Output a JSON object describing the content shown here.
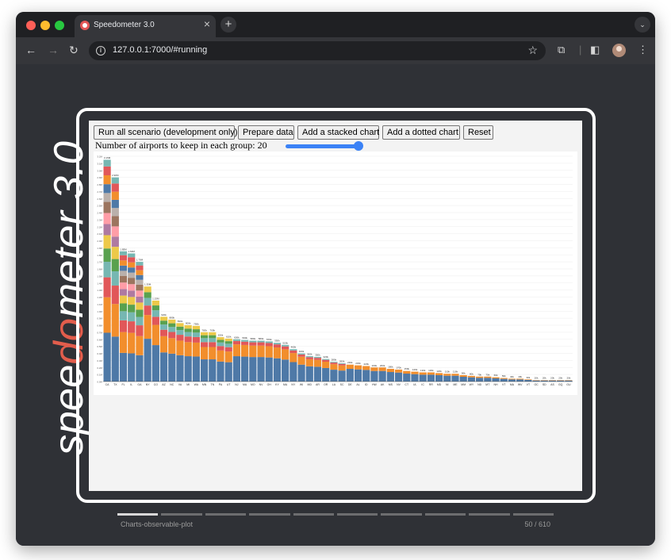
{
  "browser": {
    "tab_title": "Speedometer 3.0",
    "url": "127.0.0.1:7000/#running",
    "close_glyph": "×",
    "newtab_glyph": "+",
    "tabmenu_glyph": "⌄",
    "back_glyph": "←",
    "forward_glyph": "→",
    "reload_glyph": "↻",
    "star_glyph": "☆",
    "extensions_glyph": "⧉",
    "sidebar_glyph": "◧",
    "menu_glyph": "⋮",
    "info_glyph": "i"
  },
  "benchmark": {
    "logo_text": "speedometer 3.0",
    "current_test": "Charts-observable-plot",
    "progress": "50 / 610",
    "progress_completed_fraction": 0.082,
    "controls": {
      "run_all": "Run all scenario (development only)",
      "prepare": "Prepare data",
      "stacked": "Add a stacked chart",
      "dotted": "Add a dotted chart",
      "reset": "Reset"
    },
    "slider_label": "Number of airports to keep in each group: 20",
    "slider_value": 20
  },
  "chart_data": {
    "type": "bar",
    "stacked": true,
    "categories": [
      "CA",
      "TX",
      "FL",
      "IL",
      "GA",
      "NY",
      "CO",
      "AZ",
      "NC",
      "VA",
      "MI",
      "WA",
      "MN",
      "TN",
      "PA",
      "UT",
      "NJ",
      "MA",
      "MO",
      "NV",
      "OH",
      "KY",
      "MA",
      "NY",
      "WI",
      "MD",
      "AR",
      "OR",
      "LA",
      "SC",
      "DE",
      "AL",
      "ID",
      "HW",
      "AK",
      "MS",
      "NV",
      "CT",
      "IA",
      "IC",
      "RR",
      "MD",
      "NI",
      "ME",
      "MM",
      "WY",
      "ND",
      "MT",
      "NH",
      "VT",
      "MA",
      "WV",
      "VT",
      "OC",
      "SD",
      "AS",
      "GQ",
      "GU"
    ],
    "totals": [
      3.15,
      2.9,
      1.85,
      1.82,
      1.7,
      1.35,
      1.15,
      0.92,
      0.88,
      0.83,
      0.8,
      0.79,
      0.7,
      0.7,
      0.63,
      0.61,
      0.6,
      0.59,
      0.58,
      0.58,
      0.57,
      0.55,
      0.52,
      0.46,
      0.4,
      0.36,
      0.35,
      0.32,
      0.28,
      0.26,
      0.24,
      0.23,
      0.22,
      0.2,
      0.2,
      0.18,
      0.17,
      0.15,
      0.14,
      0.13,
      0.13,
      0.12,
      0.11,
      0.11,
      0.09,
      0.08,
      0.07,
      0.07,
      0.06,
      0.05,
      0.04,
      0.04,
      0.03,
      0.02,
      0.02,
      0.02,
      0.02,
      0.02
    ],
    "ylim": [
      0,
      3.2
    ],
    "grid": true,
    "legend": "none"
  },
  "colors": {
    "page_bg": "#2f3136",
    "frame": "#ffffff",
    "logo_accent": "#e25d4c",
    "slider": "#3b82f6",
    "palette": [
      "#4e79a7",
      "#f28e2c",
      "#e15759",
      "#76b7b2",
      "#59a14f",
      "#edc949",
      "#af7aa1",
      "#ff9da7",
      "#9c755f",
      "#bab0ab"
    ]
  }
}
